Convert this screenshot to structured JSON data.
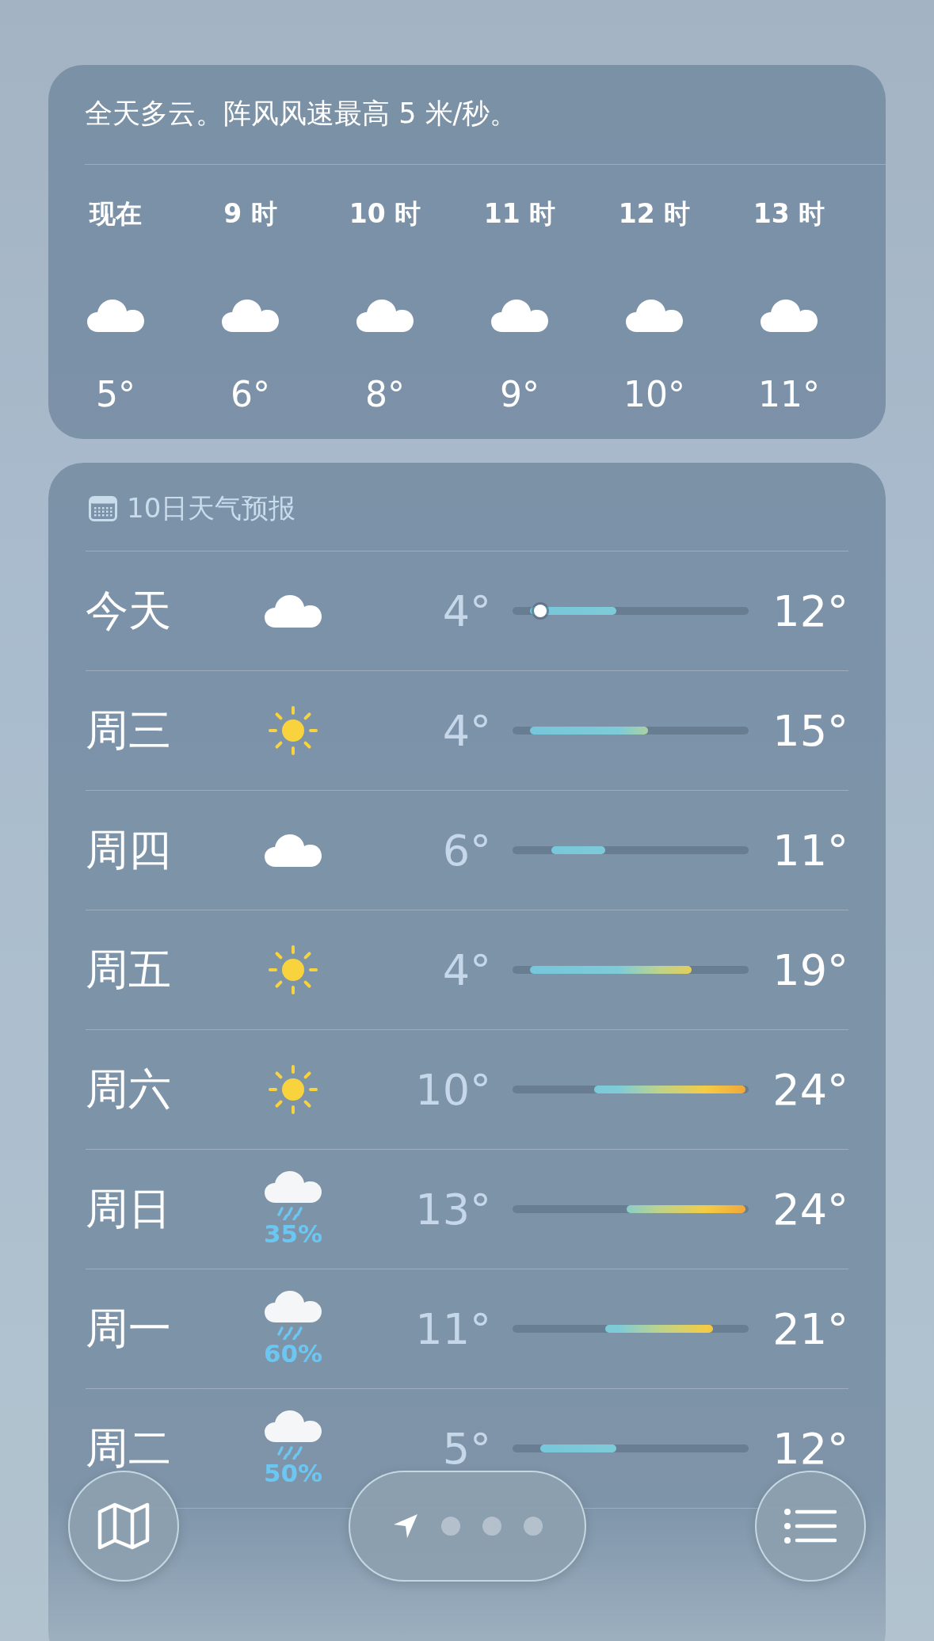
{
  "hourly": {
    "summary": "全天多云。阵风风速最高 5 米/秒。",
    "hours": [
      {
        "label": "现在",
        "kind": "cloud",
        "temp": "5°"
      },
      {
        "label": "9 时",
        "kind": "cloud",
        "temp": "6°"
      },
      {
        "label": "10 时",
        "kind": "cloud",
        "temp": "8°"
      },
      {
        "label": "11 时",
        "kind": "cloud",
        "temp": "9°"
      },
      {
        "label": "12 时",
        "kind": "cloud",
        "temp": "10°"
      },
      {
        "label": "13 时",
        "kind": "cloud",
        "temp": "11°"
      }
    ]
  },
  "forecast": {
    "title": "10日天气预报",
    "days": [
      {
        "day": "今天",
        "kind": "cloud",
        "low": "4°",
        "high": "12°",
        "current": true
      },
      {
        "day": "周三",
        "kind": "sun",
        "low": "4°",
        "high": "15°",
        "current": false
      },
      {
        "day": "周四",
        "kind": "cloud",
        "low": "6°",
        "high": "11°",
        "current": false
      },
      {
        "day": "周五",
        "kind": "sun",
        "low": "4°",
        "high": "19°",
        "current": false
      },
      {
        "day": "周六",
        "kind": "sun",
        "low": "10°",
        "high": "24°",
        "current": false
      },
      {
        "day": "周日",
        "kind": "rain",
        "pop": "35%",
        "low": "13°",
        "high": "24°",
        "current": false
      },
      {
        "day": "周一",
        "kind": "rain",
        "pop": "60%",
        "low": "11°",
        "high": "21°",
        "current": false
      },
      {
        "day": "周二",
        "kind": "rain",
        "pop": "50%",
        "low": "5°",
        "high": "12°",
        "current": false
      }
    ]
  },
  "pages": [
    {
      "kind": "location",
      "selected": true
    },
    {
      "kind": "dot",
      "selected": false
    },
    {
      "kind": "dot",
      "selected": false
    },
    {
      "kind": "dot",
      "selected": false
    }
  ]
}
